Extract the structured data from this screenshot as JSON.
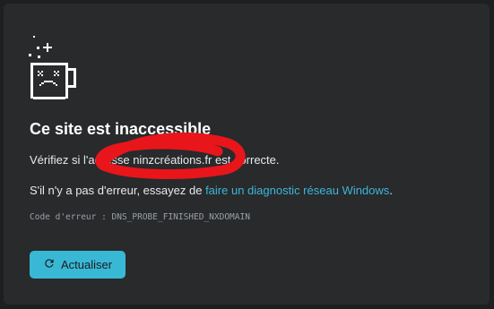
{
  "error_page": {
    "title": "Ce site est inaccessible",
    "check_prefix": "Vérifiez si l'adresse ",
    "domain": "ninzcréations.fr",
    "check_suffix": " est correcte.",
    "diag_prefix": "S'il n'y a pas d'erreur, essayez de ",
    "diag_link": "faire un diagnostic réseau Windows",
    "diag_suffix": ".",
    "error_code": "Code d'erreur : DNS_PROBE_FINISHED_NXDOMAIN",
    "reload_label": "Actualiser"
  },
  "icons": {
    "illustration": "sad-mug-icon",
    "reload": "reload-icon"
  },
  "colors": {
    "background": "#1e1f20",
    "panel": "#282a2c",
    "link": "#3eb6d8",
    "button": "#39b8d6",
    "annotation_red": "#e8151b"
  }
}
